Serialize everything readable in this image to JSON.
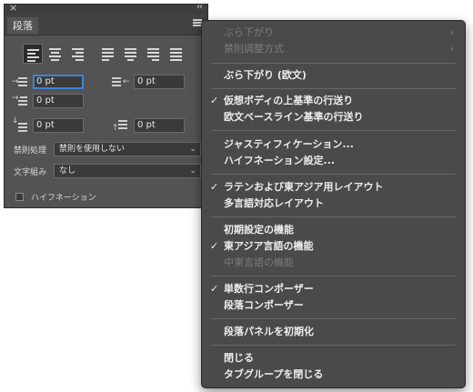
{
  "panel": {
    "close_glyph": "×",
    "collapse_glyph": "‹‹",
    "tab_label": "段落",
    "menu_icon": "hamburger-icon",
    "align_buttons": [
      "align-left",
      "align-center",
      "align-right",
      "justify-left",
      "justify-center",
      "justify-right",
      "justify-all"
    ],
    "selected_align": "align-left",
    "left_indent": "0 pt",
    "right_indent": "0 pt",
    "first_line_indent": "0 pt",
    "space_before": "0 pt",
    "space_after": "0 pt",
    "kinsoku_label": "禁則処理",
    "kinsoku_value": "禁則を使用しない",
    "mojikumi_label": "文字組み",
    "mojikumi_value": "なし",
    "hyphenation_label": "ハイフネーション",
    "hyphenation_checked": false
  },
  "menu": {
    "items": [
      {
        "label": "ぶら下がり",
        "disabled": true,
        "checked": false,
        "submenu": true
      },
      {
        "label": "禁則調整方式",
        "disabled": true,
        "checked": false,
        "submenu": true
      },
      {
        "label": "ぶら下がり (欧文)",
        "disabled": false,
        "checked": false
      },
      {
        "label": "仮想ボディの上基準の行送り",
        "disabled": false,
        "checked": true
      },
      {
        "label": "欧文ベースライン基準の行送り",
        "disabled": false,
        "checked": false
      },
      {
        "label": "ジャスティフィケーション...",
        "disabled": false,
        "checked": false
      },
      {
        "label": "ハイフネーション設定...",
        "disabled": false,
        "checked": false
      },
      {
        "label": "ラテンおよび東アジア用レイアウト",
        "disabled": false,
        "checked": true
      },
      {
        "label": "多言語対応レイアウト",
        "disabled": false,
        "checked": false
      },
      {
        "label": "初期設定の機能",
        "disabled": false,
        "checked": false
      },
      {
        "label": "東アジア言語の機能",
        "disabled": false,
        "checked": true
      },
      {
        "label": "中東言語の機能",
        "disabled": true,
        "checked": false
      },
      {
        "label": "単数行コンポーザー",
        "disabled": false,
        "checked": true
      },
      {
        "label": "段落コンポーザー",
        "disabled": false,
        "checked": false
      },
      {
        "label": "段落パネルを初期化",
        "disabled": false,
        "checked": false
      },
      {
        "label": "閉じる",
        "disabled": false,
        "checked": false
      },
      {
        "label": "タブグループを閉じる",
        "disabled": false,
        "checked": false
      }
    ],
    "check_glyph": "✓",
    "submenu_glyph": "›"
  },
  "colors": {
    "panel_bg": "#535353",
    "menu_bg": "#4a4a4a",
    "focus_ring": "#3c84d8"
  }
}
